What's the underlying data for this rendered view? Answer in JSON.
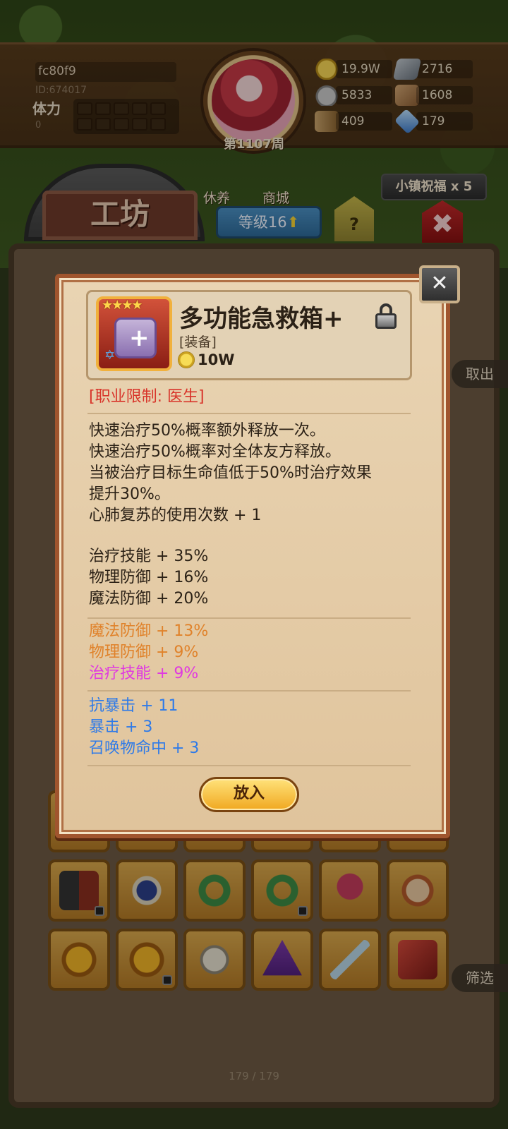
{
  "header": {
    "player_name": "fc80f9",
    "player_id": "ID:674017",
    "stamina_label": "体力",
    "stamina_value": "0",
    "week": "第1107周",
    "resources": [
      {
        "icon": "gold-coin-icon",
        "value": "19.9W"
      },
      {
        "icon": "steel-ingot-icon",
        "value": "2716"
      },
      {
        "icon": "stone-icon",
        "value": "5833"
      },
      {
        "icon": "leather-icon",
        "value": "1608"
      },
      {
        "icon": "wood-log-icon",
        "value": "409"
      },
      {
        "icon": "crystal-icon",
        "value": "179"
      }
    ]
  },
  "nav": {
    "workshop_title": "工坊",
    "rest": "休养",
    "shop": "商城",
    "level": "等级16",
    "help": "?",
    "blessing": "小镇祝福 x 5",
    "close": "✖"
  },
  "side_buttons": {
    "take_out": "取出",
    "filter": "筛选"
  },
  "inventory": {
    "page": "179 / 179",
    "slots": [
      {
        "icon": "staff-icon",
        "art": "staff",
        "locked": false
      },
      {
        "icon": "rod-icon",
        "art": "rod",
        "locked": false
      },
      {
        "icon": "drill-icon",
        "art": "drill",
        "locked": false
      },
      {
        "icon": "blue-spear-icon",
        "art": "blue",
        "locked": false
      },
      {
        "icon": "blue-spear-icon",
        "art": "blue",
        "locked": false
      },
      {
        "icon": "sword-icon",
        "art": "sword",
        "locked": false
      },
      {
        "icon": "shield-icon",
        "art": "shield",
        "locked": true
      },
      {
        "icon": "orb-icon",
        "art": "orb",
        "locked": false
      },
      {
        "icon": "ring-icon",
        "art": "ring",
        "locked": false
      },
      {
        "icon": "ring-icon",
        "art": "ring",
        "locked": true
      },
      {
        "icon": "axe-icon",
        "art": "axe",
        "locked": false
      },
      {
        "icon": "doll-icon",
        "art": "doll",
        "locked": false
      },
      {
        "icon": "dragon-ring-icon",
        "art": "dragon",
        "locked": false
      },
      {
        "icon": "dragon-ring-icon",
        "art": "dragon",
        "locked": true
      },
      {
        "icon": "skull-staff-icon",
        "art": "skull",
        "locked": false
      },
      {
        "icon": "wizard-hat-icon",
        "art": "hat",
        "locked": false
      },
      {
        "icon": "blade-icon",
        "art": "blade",
        "locked": false
      },
      {
        "icon": "tablet-icon",
        "art": "tablet",
        "locked": false
      }
    ]
  },
  "item": {
    "name": "多功能急救箱+",
    "type": "[装备]",
    "price": "10W",
    "stars": "★★★★",
    "restriction": "[职业限制: 医生]",
    "description": [
      "快速治疗50%概率额外释放一次。",
      "快速治疗50%概率对全体友方释放。",
      "当被治疗目标生命值低于50%时治疗效果",
      "提升30%。",
      "心肺复苏的使用次数 + 1"
    ],
    "base_stats": [
      "治疗技能 + 35%",
      "物理防御 + 16%",
      "魔法防御 + 20%"
    ],
    "bonus_stats": [
      {
        "text": "魔法防御 + 13%",
        "color": "#e0822a"
      },
      {
        "text": "物理防御 + 9%",
        "color": "#e0822a"
      },
      {
        "text": "治疗技能 + 9%",
        "color": "#e03ae0"
      }
    ],
    "extra_stats": [
      "抗暴击 + 11",
      "暴击 + 3",
      "召唤物命中 + 3"
    ],
    "action_button": "放入"
  }
}
